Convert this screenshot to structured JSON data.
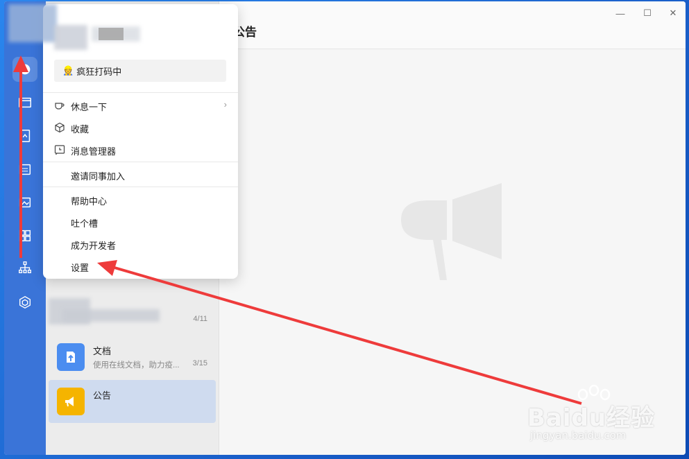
{
  "main": {
    "title": "公告"
  },
  "window_controls": {
    "minimize": "—",
    "maximize": "☐",
    "close": "✕"
  },
  "list": {
    "items": [
      {
        "title": "",
        "subtitle": "",
        "date": "4/11"
      },
      {
        "title": "文档",
        "subtitle": "使用在线文档，助力疫...",
        "date": "3/15"
      },
      {
        "title": "公告",
        "subtitle": "",
        "date": ""
      }
    ]
  },
  "popup": {
    "status": "疯狂打码中",
    "menu": [
      {
        "label": "休息一下",
        "icon": "coffee-icon",
        "has_submenu": true
      },
      {
        "label": "收藏",
        "icon": "cube-icon"
      },
      {
        "label": "消息管理器",
        "icon": "clock-icon"
      },
      {
        "label": "邀请同事加入",
        "icon": ""
      },
      {
        "label": "帮助中心",
        "icon": ""
      },
      {
        "label": "吐个槽",
        "icon": ""
      },
      {
        "label": "成为开发者",
        "icon": ""
      },
      {
        "label": "设置",
        "icon": ""
      }
    ]
  },
  "watermark": {
    "main": "Baidu经验",
    "sub": "jingyan.baidu.com"
  },
  "colors": {
    "sidebar": "#3a74d8",
    "selected_item": "#cfdbef",
    "arrow": "#ee3b3b",
    "doc_icon_bg": "#4b8df0",
    "notice_icon_bg": "#f5b400"
  }
}
